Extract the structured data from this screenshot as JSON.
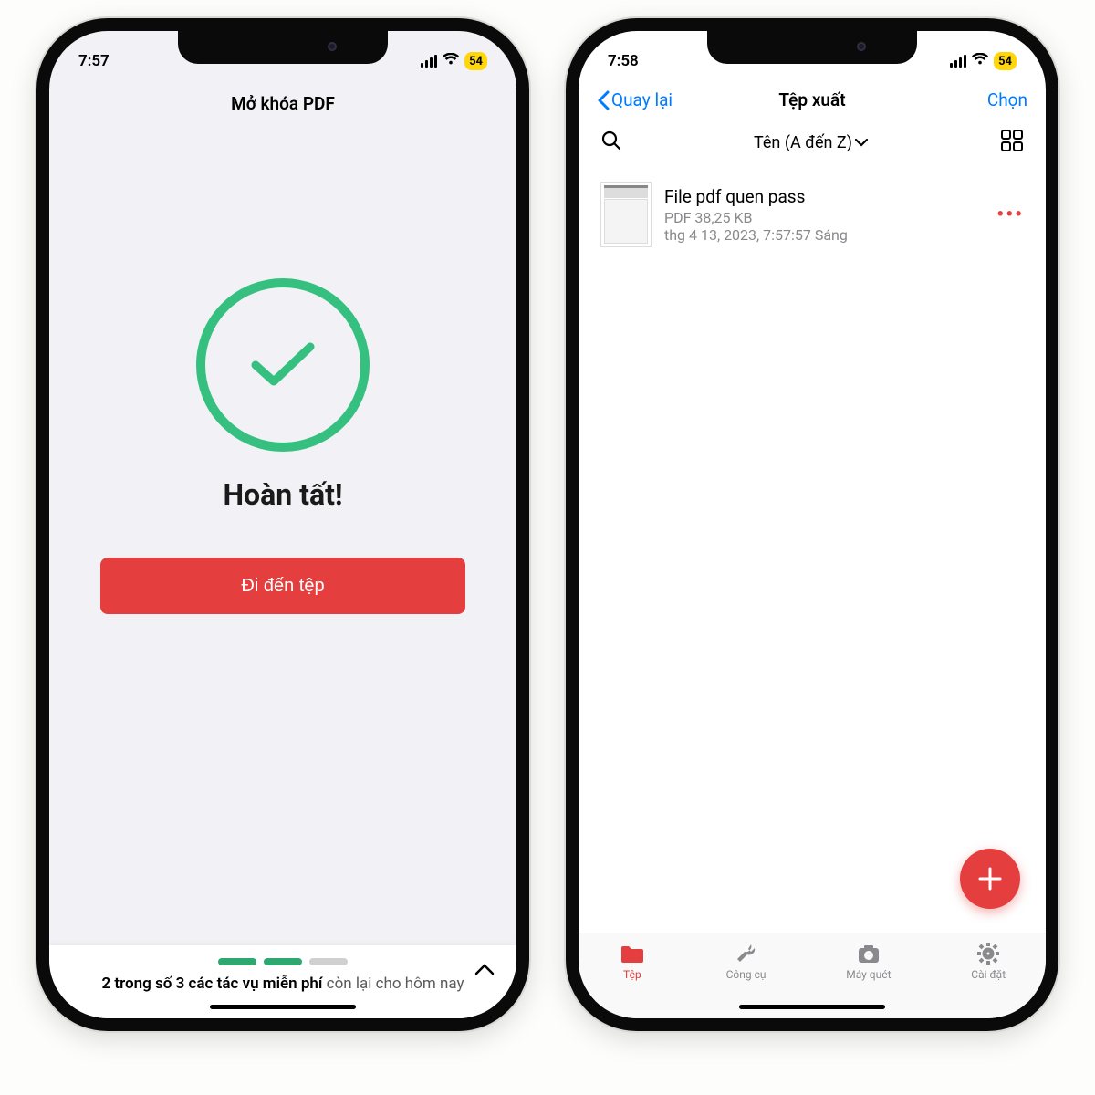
{
  "statusbar": {
    "time_left": "7:57",
    "time_right": "7:58",
    "battery": "54"
  },
  "screen1": {
    "title": "Mở khóa PDF",
    "done": "Hoàn tất!",
    "cta": "Đi đến tệp",
    "footer_bold": "2 trong số 3 các tác vụ miễn phí",
    "footer_rest": " còn lại cho hôm nay"
  },
  "screen2": {
    "back": "Quay lại",
    "title": "Tệp xuất",
    "select": "Chọn",
    "sort": "Tên (A đến Z)",
    "file": {
      "name": "File pdf quen pass",
      "meta1": "PDF 38,25 KB",
      "meta2": "thg 4 13, 2023, 7:57:57 Sáng"
    },
    "tabs": {
      "files": "Tệp",
      "tools": "Công cụ",
      "scanner": "Máy quét",
      "settings": "Cài đặt"
    }
  }
}
